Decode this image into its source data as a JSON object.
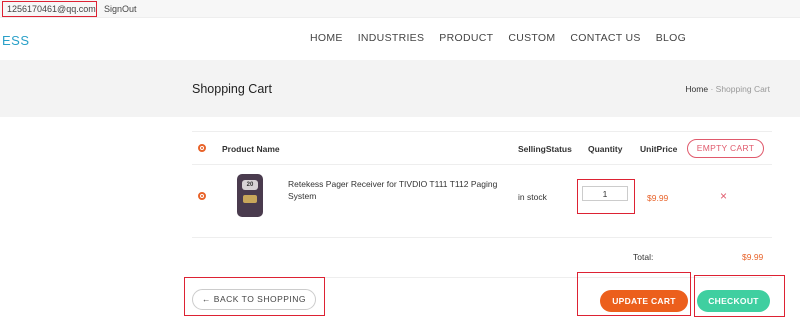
{
  "topbar": {
    "email": "1256170461@qq.com",
    "signout": "SignOut"
  },
  "logo": "ESS",
  "nav": [
    "HOME",
    "INDUSTRIES",
    "PRODUCT",
    "CUSTOM",
    "CONTACT US",
    "BLOG"
  ],
  "page": {
    "title": "Shopping Cart",
    "crumb_home": "Home",
    "crumb_sep": "·",
    "crumb_current": "Shopping Cart"
  },
  "table": {
    "headers": {
      "product": "Product Name",
      "status": "SellingStatus",
      "quantity": "Quantity",
      "price": "UnitPrice"
    },
    "empty_cart": "EMPTY CART",
    "item": {
      "thumb_badge": "20",
      "name": "Retekess Pager Receiver for TIVDIO T111 T112 Paging System",
      "status": "in stock",
      "quantity": "1",
      "price": "$9.99",
      "remove": "×"
    },
    "total_label": "Total:",
    "total_value": "$9.99"
  },
  "actions": {
    "back": "← BACK TO SHOPPING",
    "update": "UPDATE CART",
    "checkout": "CHECKOUT"
  },
  "colors": {
    "accent_orange": "#ec5f1c",
    "accent_green": "#3fcfa0",
    "accent_pink": "#e05a6c",
    "logo_blue": "#2aa0c8",
    "annotation_red": "#dd2233"
  }
}
